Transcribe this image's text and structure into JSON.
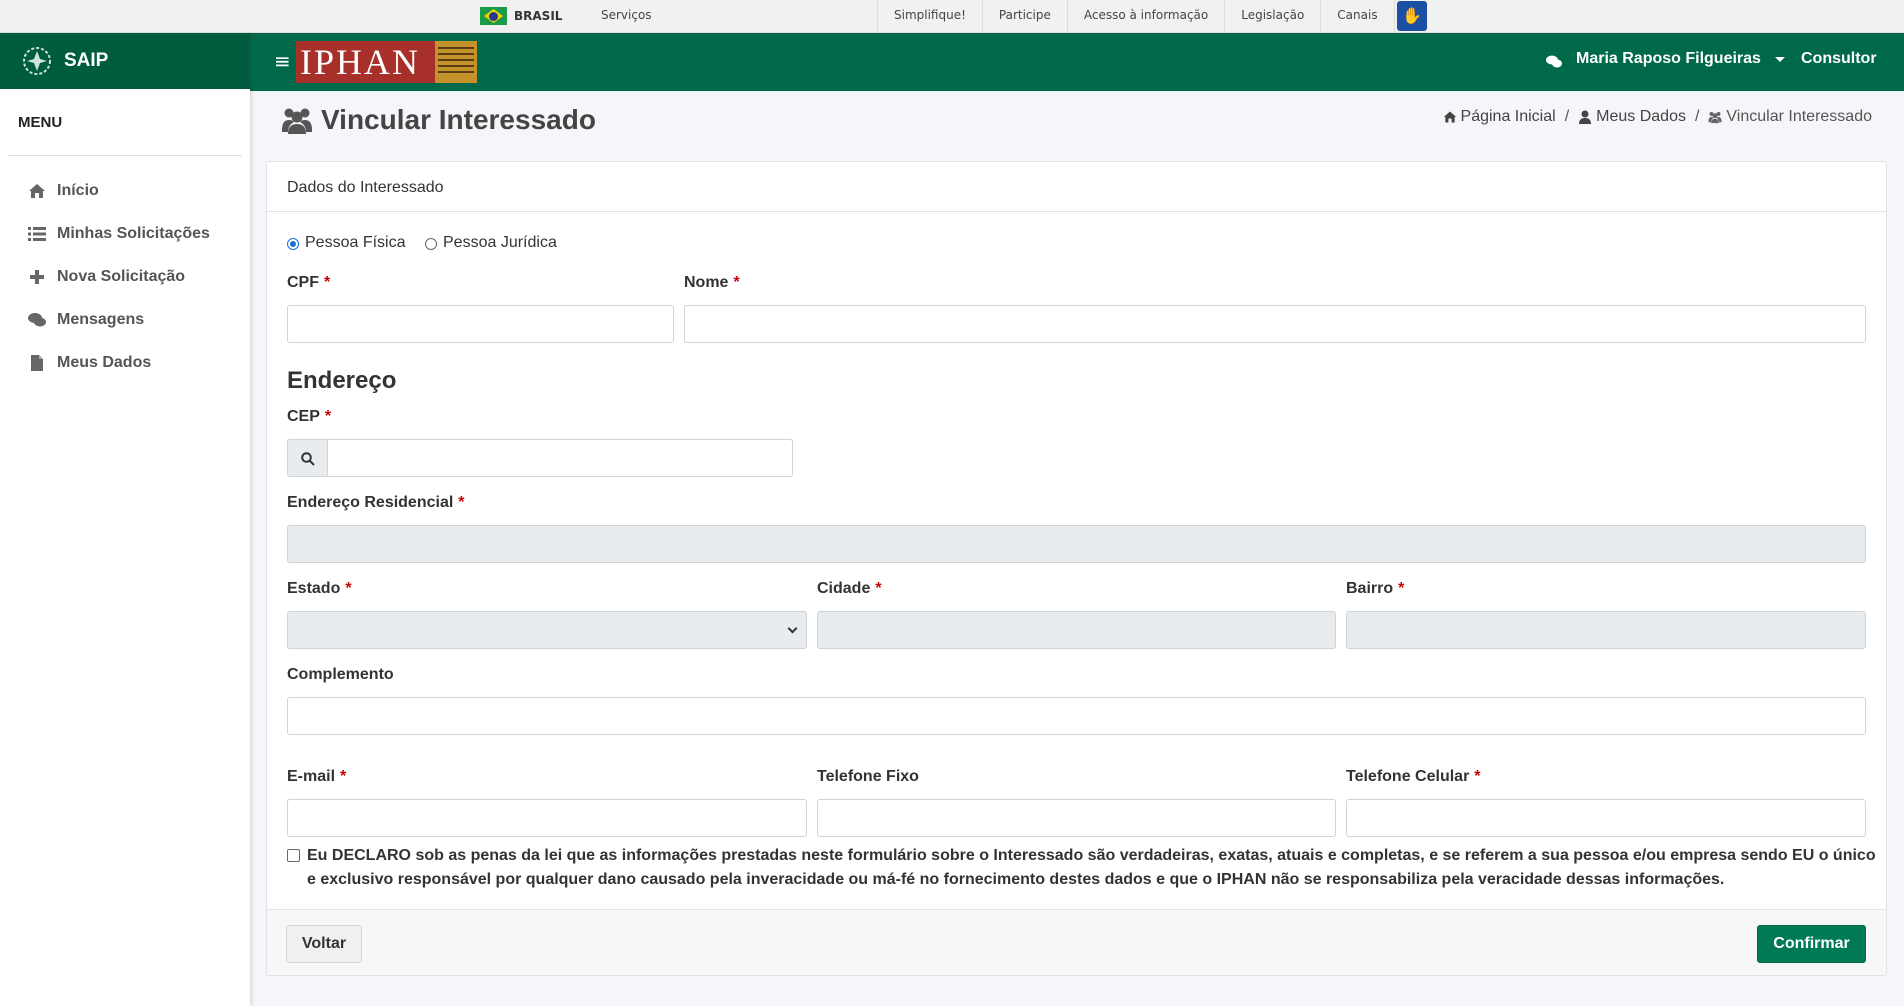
{
  "gov_bar": {
    "country": "BRASIL",
    "services": "Serviços",
    "links": [
      "Simplifique!",
      "Participe",
      "Acesso à informação",
      "Legislação",
      "Canais"
    ]
  },
  "brand": {
    "name": "SAIP",
    "logo_icon": "leaf-seal-icon"
  },
  "header": {
    "logo_text": "IPHAN",
    "user_name": "Maria Raposo Filgueiras",
    "role": "Consultor"
  },
  "sidebar": {
    "title": "MENU",
    "items": [
      {
        "label": "Início",
        "icon": "home-icon"
      },
      {
        "label": "Minhas Solicitações",
        "icon": "list-icon"
      },
      {
        "label": "Nova Solicitação",
        "icon": "plus-icon"
      },
      {
        "label": "Mensagens",
        "icon": "comments-icon"
      },
      {
        "label": "Meus Dados",
        "icon": "file-icon"
      }
    ]
  },
  "page": {
    "title": "Vincular Interessado",
    "breadcrumb": [
      "Página Inicial",
      "Meus Dados",
      "Vincular Interessado"
    ]
  },
  "form": {
    "card_title": "Dados do Interessado",
    "person_type": {
      "options": [
        "Pessoa Física",
        "Pessoa Jurídica"
      ],
      "selected": "Pessoa Física"
    },
    "cpf_label": "CPF",
    "cpf_value": "",
    "nome_label": "Nome",
    "nome_value": "",
    "address_section": "Endereço",
    "cep_label": "CEP",
    "cep_value": "",
    "endereco_label": "Endereço Residencial",
    "endereco_value": "",
    "estado_label": "Estado",
    "estado_value": "",
    "cidade_label": "Cidade",
    "cidade_value": "",
    "bairro_label": "Bairro",
    "bairro_value": "",
    "complemento_label": "Complemento",
    "complemento_value": "",
    "email_label": "E-mail",
    "email_value": "",
    "telefone_fixo_label": "Telefone Fixo",
    "telefone_fixo_value": "",
    "telefone_celular_label": "Telefone Celular",
    "telefone_celular_value": "",
    "required_mark": "*",
    "declaration_checked": false,
    "declaration": "Eu DECLARO sob as penas da lei que as informações prestadas neste formulário sobre o Interessado são verdadeiras, exatas, atuais e completas, e se referem a sua pessoa e/ou empresa sendo EU o único e exclusivo responsável por qualquer dano causado pela inveracidade ou má-fé no fornecimento destes dados e que o IPHAN não se responsabiliza pela veracidade dessas informações.",
    "back_button": "Voltar",
    "confirm_button": "Confirmar"
  },
  "colors": {
    "header_green": "#00694a",
    "brand_green": "#005c3e",
    "confirm_green": "#007a55",
    "required_red": "#cc0000",
    "radio_blue": "#1f6fd1"
  }
}
